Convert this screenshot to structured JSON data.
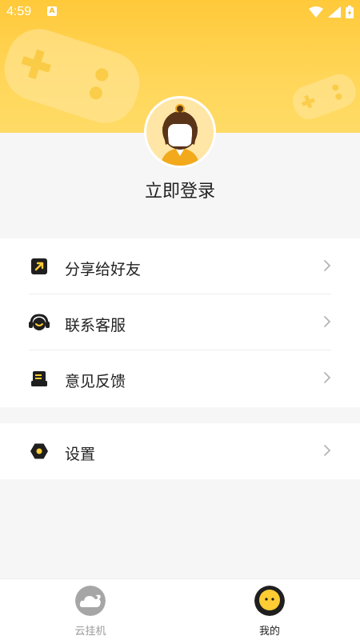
{
  "status_bar": {
    "time": "4:59",
    "indicator": "A"
  },
  "profile": {
    "login_label": "立即登录"
  },
  "menu": {
    "items": [
      {
        "label": "分享给好友",
        "icon": "share-icon"
      },
      {
        "label": "联系客服",
        "icon": "headset-icon"
      },
      {
        "label": "意见反馈",
        "icon": "feedback-icon"
      }
    ],
    "settings": {
      "label": "设置",
      "icon": "settings-icon"
    }
  },
  "bottom_nav": {
    "items": [
      {
        "label": "云挂机",
        "active": false
      },
      {
        "label": "我的",
        "active": true
      }
    ]
  },
  "colors": {
    "accent": "#ffcc33",
    "dark": "#1f1f1f",
    "inactive": "#9a9a9a"
  }
}
